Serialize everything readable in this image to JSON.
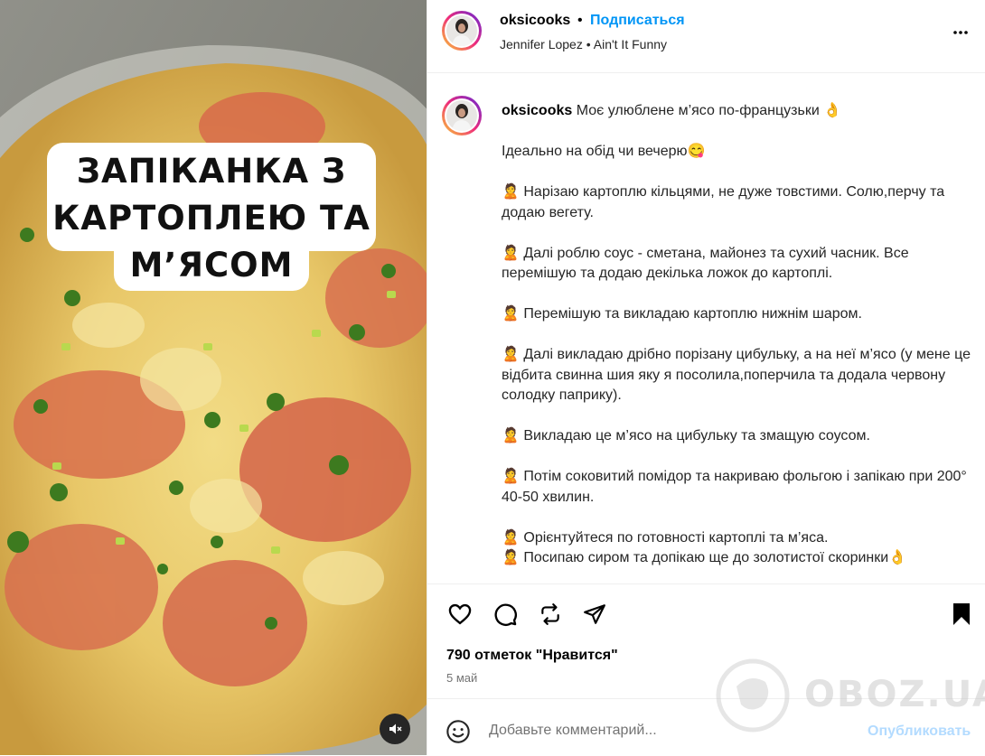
{
  "media": {
    "overlay_text": "ЗАПІКАНКА З\nКАРТОПЛЕЮ ТА\nМ’ЯСОМ"
  },
  "header": {
    "username": "oksicooks",
    "separator": "•",
    "follow_label": "Подписаться",
    "music": "Jennifer Lopez • Ain't It Funny",
    "more_icon": "more-horizontal-icon"
  },
  "caption": {
    "username": "oksicooks",
    "lines": [
      "Моє улюблене м’ясо по-французьки 👌",
      "",
      "Ідеально на обід чи вечерю😋",
      "",
      "🙎 Нарізаю картоплю кільцями, не дуже товстими. Солю,перчу та додаю вегету.",
      "",
      "🙎 Далі роблю соус - сметана, майонез та сухий часник. Все перемішую та додаю декілька ложок до картоплі.",
      "",
      "🙎 Перемішую та викладаю картоплю нижнім шаром.",
      "",
      "🙎 Далі викладаю дрібно порізану цибульку, а на неї м’ясо (у мене це відбита свинна шия яку я посолила,поперчила та додала червону солодку паприку).",
      "",
      "🙎 Викладаю це м’ясо на цибульку та змащую соусом.",
      "",
      "🙎 Потім соковитий помідор та накриваю фольгою і запікаю при 200° 40-50 хвилин.",
      "",
      "🙎 Орієнтуйтеся по готовності картоплі та м’яса.",
      "🙎 Посипаю сиром та допікаю ще до золотистої скоринки👌"
    ]
  },
  "actions": {
    "like_icon": "heart-icon",
    "comment_icon": "comment-icon",
    "repost_icon": "repost-icon",
    "share_icon": "share-icon",
    "save_icon": "bookmark-icon"
  },
  "likes": "790 отметок \"Нравится\"",
  "date": "5 май",
  "comment": {
    "placeholder": "Добавьте комментарий...",
    "post_label": "Опубликовать",
    "emoji_icon": "emoji-icon"
  },
  "watermark": "OBOZ.UA",
  "colors": {
    "accent": "#0095f6",
    "post_disabled": "#b3dbff",
    "muted": "#737373"
  }
}
